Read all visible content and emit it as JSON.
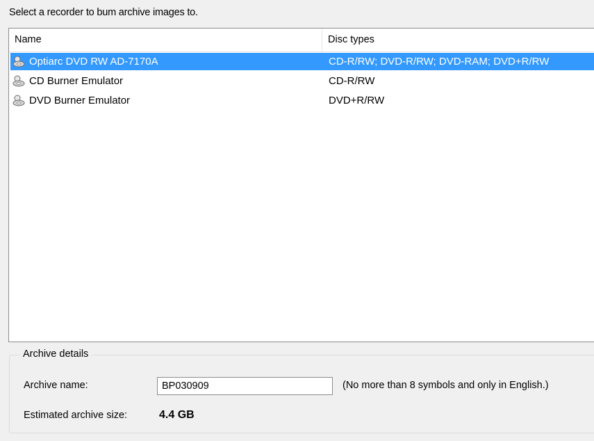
{
  "instruction": "Select a recorder to bum archive images to.",
  "list": {
    "columns": {
      "name": "Name",
      "disc_types": "Disc types"
    },
    "rows": [
      {
        "name": "Optiarc  DVD RW AD-7170A",
        "disc_types": "CD-R/RW; DVD-R/RW; DVD-RAM; DVD+R/RW",
        "icon": "disc-drive-icon",
        "selected": true
      },
      {
        "name": "CD Burner Emulator",
        "disc_types": "CD-R/RW",
        "icon": "disc-drive-icon",
        "selected": false
      },
      {
        "name": "DVD Burner Emulator",
        "disc_types": "DVD+R/RW",
        "icon": "disc-drive-icon",
        "selected": false
      }
    ]
  },
  "details": {
    "group_title": "Archive details",
    "archive_name_label": "Archive name:",
    "archive_name_value": "BP030909",
    "archive_name_hint": "(No more than 8 symbols and only in English.)",
    "size_label": "Estimated archive size:",
    "size_value": "4.4 GB"
  },
  "colors": {
    "selection": "#3399ff",
    "background": "#f0f0f0"
  }
}
